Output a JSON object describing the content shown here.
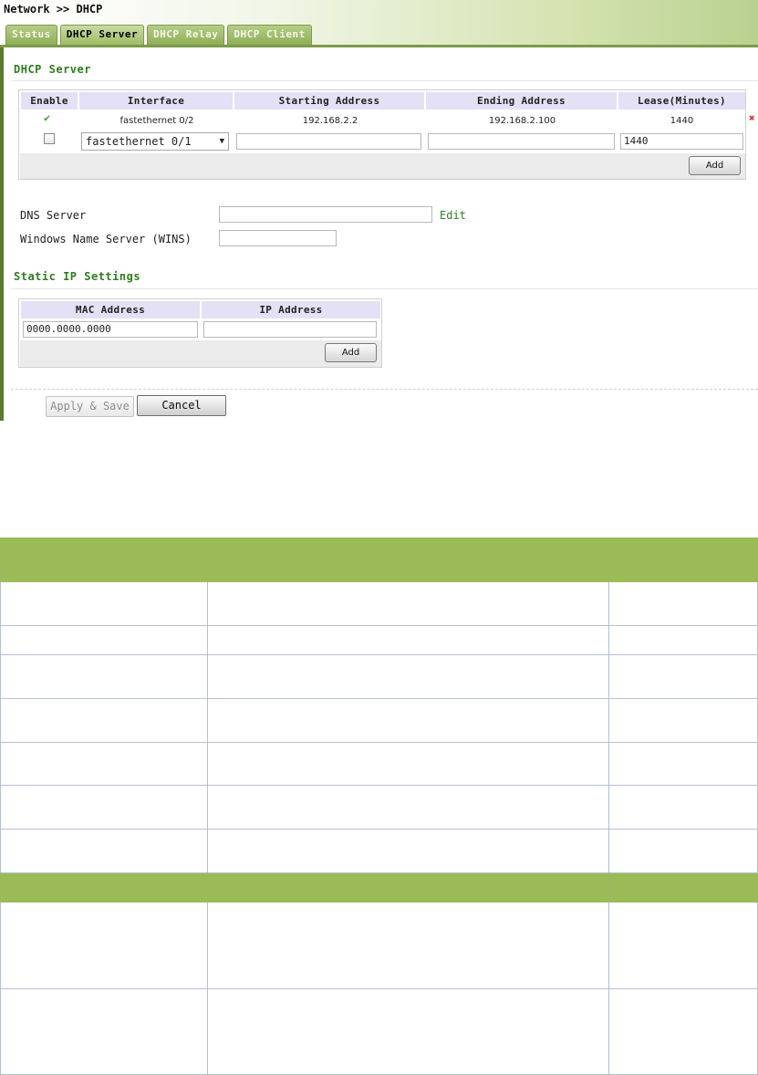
{
  "header": {
    "breadcrumb": "Network >> DHCP",
    "tabs": [
      {
        "label": "Status",
        "active": false
      },
      {
        "label": "DHCP Server",
        "active": true
      },
      {
        "label": "DHCP Relay",
        "active": false
      },
      {
        "label": "DHCP Client",
        "active": false
      }
    ]
  },
  "dhcp_server": {
    "title": "DHCP Server",
    "columns": [
      "Enable",
      "Interface",
      "Starting Address",
      "Ending Address",
      "Lease(Minutes)"
    ],
    "rows": [
      {
        "enabled": true,
        "interface": "fastethernet 0/2",
        "start": "192.168.2.2",
        "end": "192.168.2.100",
        "lease": "1440"
      }
    ],
    "new_row": {
      "interface": "fastethernet 0/1",
      "start": "",
      "end": "",
      "lease": "1440"
    },
    "add_label": "Add",
    "dns_label": "DNS Server",
    "dns_value": "",
    "edit_label": "Edit",
    "wins_label": "Windows Name Server (WINS)",
    "wins_value": ""
  },
  "static_ip": {
    "title": "Static IP Settings",
    "columns": [
      "MAC Address",
      "IP Address"
    ],
    "mac_value": "0000.0000.0000",
    "ip_value": "",
    "add_label": "Add"
  },
  "actions": {
    "apply_label": "Apply & Save",
    "cancel_label": "Cancel"
  },
  "colors": {
    "accent_green": "#2f7d1e",
    "tab_green": "#9fbc68",
    "table_header": "#9bbb59",
    "grid_header": "#e4e0f6"
  }
}
